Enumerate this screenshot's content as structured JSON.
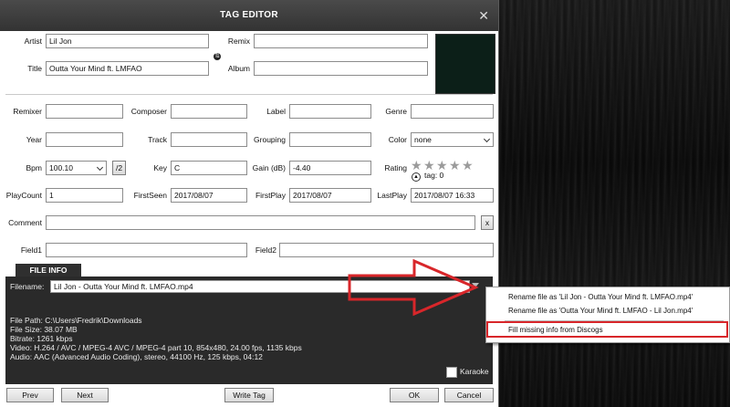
{
  "window": {
    "title": "TAG EDITOR",
    "close_glyph": "✕",
    "accent_color": "#d8262a"
  },
  "labels": {
    "artist": "Artist",
    "title": "Title",
    "remix": "Remix",
    "album": "Album",
    "remixer": "Remixer",
    "composer": "Composer",
    "label": "Label",
    "genre": "Genre",
    "year": "Year",
    "track": "Track",
    "grouping": "Grouping",
    "color": "Color",
    "bpm": "Bpm",
    "key": "Key",
    "gain": "Gain (dB)",
    "rating": "Rating",
    "playcount": "PlayCount",
    "firstseen": "FirstSeen",
    "firstplay": "FirstPlay",
    "lastplay": "LastPlay",
    "comment": "Comment",
    "field1": "Field1",
    "field2": "Field2"
  },
  "values": {
    "artist": "Lil Jon",
    "title": "Outta Your Mind ft. LMFAO",
    "remix": "",
    "album": "",
    "remixer": "",
    "composer": "",
    "label": "",
    "genre": "",
    "year": "",
    "track": "",
    "grouping": "",
    "color": "none",
    "bpm": "100.10",
    "bpm_half_button": "/2",
    "key": "C",
    "gain": "-4.40",
    "playcount": "1",
    "firstseen": "2017/08/07",
    "firstplay": "2017/08/07",
    "lastplay": "2017/08/07 16:33",
    "comment": "",
    "comment_clear": "x",
    "field1": "",
    "field2": ""
  },
  "rating": {
    "stars_filled": 0,
    "stars_total": 5,
    "star_glyph": "★",
    "tag_text": "tag: 0",
    "tag_icon": "up-arrow-icon"
  },
  "file_info": {
    "tab_label": "FILE INFO",
    "filename_label": "Filename:",
    "filename": "Lil Jon - Outta Your Mind ft. LMFAO.mp4",
    "file_path": "File Path: C:\\Users\\Fredrik\\Downloads",
    "file_size": "File Size: 38.07 MB",
    "bitrate": "Bitrate: 1261 kbps",
    "video": "Video: H.264 / AVC / MPEG-4 AVC / MPEG-4 part 10, 854x480, 24.00 fps, 1135 kbps",
    "audio": "Audio: AAC (Advanced Audio Coding), stereo, 44100 Hz, 125 kbps, 04:12",
    "karaoke_label": "Karaoke"
  },
  "buttons": {
    "prev": "Prev",
    "next": "Next",
    "write_tag": "Write Tag",
    "ok": "OK",
    "cancel": "Cancel"
  },
  "context_menu": {
    "items": [
      "Rename file as 'Lil Jon - Outta Your Mind ft. LMFAO.mp4'",
      "Rename file as 'Outta Your Mind ft. LMFAO - Lil Jon.mp4'",
      "Fill missing info from Discogs"
    ]
  }
}
